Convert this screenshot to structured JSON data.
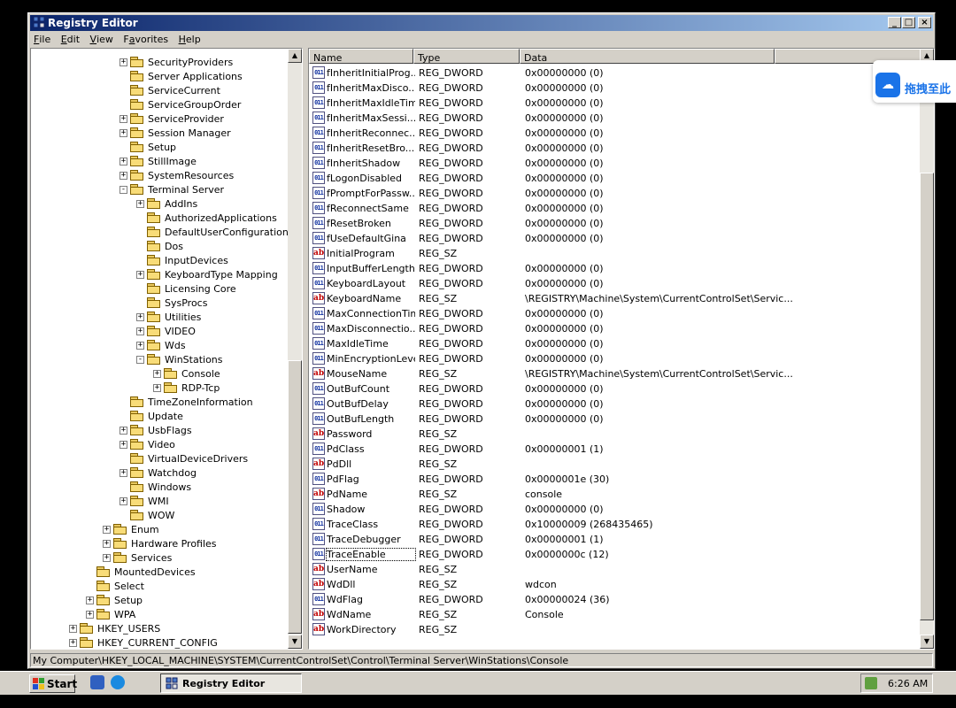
{
  "window": {
    "title": "Registry Editor",
    "min_glyph": "_",
    "max_glyph": "□",
    "close_glyph": "×"
  },
  "menu": [
    {
      "accel": "F",
      "rest": "ile"
    },
    {
      "accel": "E",
      "rest": "dit"
    },
    {
      "accel": "V",
      "rest": "iew"
    },
    {
      "pre": "F",
      "accel": "a",
      "rest": "vorites"
    },
    {
      "accel": "H",
      "rest": "elp"
    }
  ],
  "tree": [
    {
      "label": "SecurityProviders",
      "expander": "+"
    },
    {
      "label": "Server Applications",
      "expander": ""
    },
    {
      "label": "ServiceCurrent",
      "expander": ""
    },
    {
      "label": "ServiceGroupOrder",
      "expander": ""
    },
    {
      "label": "ServiceProvider",
      "expander": "+"
    },
    {
      "label": "Session Manager",
      "expander": "+"
    },
    {
      "label": "Setup",
      "expander": ""
    },
    {
      "label": "StillImage",
      "expander": "+"
    },
    {
      "label": "SystemResources",
      "expander": "+"
    },
    {
      "label": "Terminal Server",
      "expander": "−"
    },
    {
      "label": "AddIns",
      "expander": "+"
    },
    {
      "label": "AuthorizedApplications",
      "expander": ""
    },
    {
      "label": "DefaultUserConfiguration",
      "expander": ""
    },
    {
      "label": "Dos",
      "expander": ""
    },
    {
      "label": "InputDevices",
      "expander": ""
    },
    {
      "label": "KeyboardType Mapping",
      "expander": "+"
    },
    {
      "label": "Licensing Core",
      "expander": ""
    },
    {
      "label": "SysProcs",
      "expander": ""
    },
    {
      "label": "Utilities",
      "expander": "+"
    },
    {
      "label": "VIDEO",
      "expander": "+"
    },
    {
      "label": "Wds",
      "expander": "+"
    },
    {
      "label": "WinStations",
      "expander": "−"
    },
    {
      "label": "Console",
      "expander": "+"
    },
    {
      "label": "RDP-Tcp",
      "expander": "+"
    },
    {
      "label": "TimeZoneInformation",
      "expander": ""
    },
    {
      "label": "Update",
      "expander": ""
    },
    {
      "label": "UsbFlags",
      "expander": "+"
    },
    {
      "label": "Video",
      "expander": "+"
    },
    {
      "label": "VirtualDeviceDrivers",
      "expander": ""
    },
    {
      "label": "Watchdog",
      "expander": "+"
    },
    {
      "label": "Windows",
      "expander": ""
    },
    {
      "label": "WMI",
      "expander": "+"
    },
    {
      "label": "WOW",
      "expander": ""
    },
    {
      "label": "Enum",
      "expander": "+"
    },
    {
      "label": "Hardware Profiles",
      "expander": "+"
    },
    {
      "label": "Services",
      "expander": "+"
    },
    {
      "label": "MountedDevices",
      "expander": ""
    },
    {
      "label": "Select",
      "expander": ""
    },
    {
      "label": "Setup",
      "expander": "+"
    },
    {
      "label": "WPA",
      "expander": "+"
    },
    {
      "label": "HKEY_USERS",
      "expander": "+"
    },
    {
      "label": "HKEY_CURRENT_CONFIG",
      "expander": "+"
    }
  ],
  "columns": {
    "name": "Name",
    "type": "Type",
    "data": "Data"
  },
  "values": [
    {
      "name": "fInheritInitialProg...",
      "type": "REG_DWORD",
      "data": "0x00000000 (0)"
    },
    {
      "name": "fInheritMaxDisco...",
      "type": "REG_DWORD",
      "data": "0x00000000 (0)"
    },
    {
      "name": "fInheritMaxIdleTime",
      "type": "REG_DWORD",
      "data": "0x00000000 (0)"
    },
    {
      "name": "fInheritMaxSessi...",
      "type": "REG_DWORD",
      "data": "0x00000000 (0)"
    },
    {
      "name": "fInheritReconnec...",
      "type": "REG_DWORD",
      "data": "0x00000000 (0)"
    },
    {
      "name": "fInheritResetBro...",
      "type": "REG_DWORD",
      "data": "0x00000000 (0)"
    },
    {
      "name": "fInheritShadow",
      "type": "REG_DWORD",
      "data": "0x00000000 (0)"
    },
    {
      "name": "fLogonDisabled",
      "type": "REG_DWORD",
      "data": "0x00000000 (0)"
    },
    {
      "name": "fPromptForPassw...",
      "type": "REG_DWORD",
      "data": "0x00000000 (0)"
    },
    {
      "name": "fReconnectSame",
      "type": "REG_DWORD",
      "data": "0x00000000 (0)"
    },
    {
      "name": "fResetBroken",
      "type": "REG_DWORD",
      "data": "0x00000000 (0)"
    },
    {
      "name": "fUseDefaultGina",
      "type": "REG_DWORD",
      "data": "0x00000000 (0)"
    },
    {
      "name": "InitialProgram",
      "type": "REG_SZ",
      "data": ""
    },
    {
      "name": "InputBufferLength",
      "type": "REG_DWORD",
      "data": "0x00000000 (0)"
    },
    {
      "name": "KeyboardLayout",
      "type": "REG_DWORD",
      "data": "0x00000000 (0)"
    },
    {
      "name": "KeyboardName",
      "type": "REG_SZ",
      "data": "\\REGISTRY\\Machine\\System\\CurrentControlSet\\Servic..."
    },
    {
      "name": "MaxConnectionTime",
      "type": "REG_DWORD",
      "data": "0x00000000 (0)"
    },
    {
      "name": "MaxDisconnectio...",
      "type": "REG_DWORD",
      "data": "0x00000000 (0)"
    },
    {
      "name": "MaxIdleTime",
      "type": "REG_DWORD",
      "data": "0x00000000 (0)"
    },
    {
      "name": "MinEncryptionLevel",
      "type": "REG_DWORD",
      "data": "0x00000000 (0)"
    },
    {
      "name": "MouseName",
      "type": "REG_SZ",
      "data": "\\REGISTRY\\Machine\\System\\CurrentControlSet\\Servic..."
    },
    {
      "name": "OutBufCount",
      "type": "REG_DWORD",
      "data": "0x00000000 (0)"
    },
    {
      "name": "OutBufDelay",
      "type": "REG_DWORD",
      "data": "0x00000000 (0)"
    },
    {
      "name": "OutBufLength",
      "type": "REG_DWORD",
      "data": "0x00000000 (0)"
    },
    {
      "name": "Password",
      "type": "REG_SZ",
      "data": ""
    },
    {
      "name": "PdClass",
      "type": "REG_DWORD",
      "data": "0x00000001 (1)"
    },
    {
      "name": "PdDll",
      "type": "REG_SZ",
      "data": ""
    },
    {
      "name": "PdFlag",
      "type": "REG_DWORD",
      "data": "0x0000001e (30)"
    },
    {
      "name": "PdName",
      "type": "REG_SZ",
      "data": "console"
    },
    {
      "name": "Shadow",
      "type": "REG_DWORD",
      "data": "0x00000000 (0)"
    },
    {
      "name": "TraceClass",
      "type": "REG_DWORD",
      "data": "0x10000009 (268435465)"
    },
    {
      "name": "TraceDebugger",
      "type": "REG_DWORD",
      "data": "0x00000001 (1)"
    },
    {
      "name": "TraceEnable",
      "type": "REG_DWORD",
      "data": "0x0000000c (12)"
    },
    {
      "name": "UserName",
      "type": "REG_SZ",
      "data": ""
    },
    {
      "name": "WdDll",
      "type": "REG_SZ",
      "data": "wdcon"
    },
    {
      "name": "WdFlag",
      "type": "REG_DWORD",
      "data": "0x00000024 (36)"
    },
    {
      "name": "WdName",
      "type": "REG_SZ",
      "data": "Console"
    },
    {
      "name": "WorkDirectory",
      "type": "REG_SZ",
      "data": ""
    }
  ],
  "status_path": "My Computer\\HKEY_LOCAL_MACHINE\\SYSTEM\\CurrentControlSet\\Control\\Terminal Server\\WinStations\\Console",
  "taskbar": {
    "start_label": "Start",
    "task_label": "Registry Editor",
    "clock": "6:26 AM"
  },
  "float_button": {
    "label": "拖拽至此"
  },
  "icons": {
    "app": "registry-editor-icon",
    "folder": "folder-icon",
    "string_value": "reg-sz-icon",
    "dword_value": "reg-dword-icon"
  },
  "colors": {
    "titlebar_start": "#0a246a",
    "titlebar_end": "#a6caf0",
    "float_accent": "#1a73e8"
  }
}
